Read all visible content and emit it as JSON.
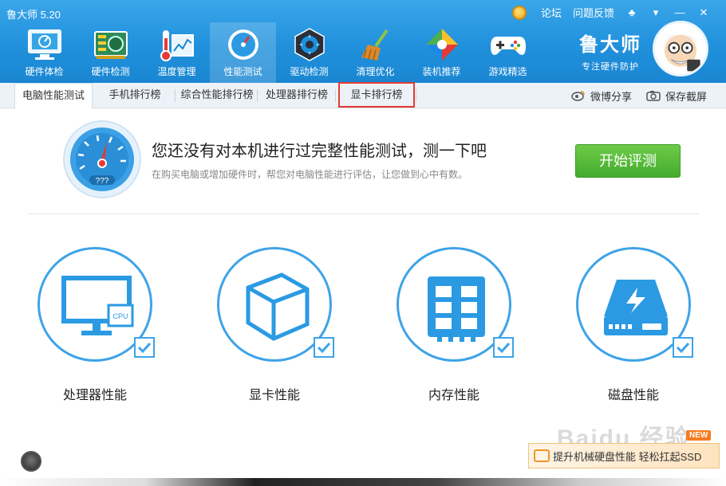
{
  "app": {
    "title": "鲁大师 5.20"
  },
  "topbar": {
    "forum": "论坛",
    "feedback": "问题反馈",
    "skin": "♣",
    "menu": "▾",
    "minimize": "—",
    "close": "✕"
  },
  "nav": [
    {
      "label": "硬件体检",
      "icon": "monitor-icon"
    },
    {
      "label": "硬件检测",
      "icon": "circuit-board-icon"
    },
    {
      "label": "温度管理",
      "icon": "thermometer-icon"
    },
    {
      "label": "性能测试",
      "icon": "speedometer-icon",
      "active": true
    },
    {
      "label": "驱动检测",
      "icon": "gear-icon"
    },
    {
      "label": "清理优化",
      "icon": "broom-icon"
    },
    {
      "label": "装机推荐",
      "icon": "cube-icon"
    },
    {
      "label": "游戏精选",
      "icon": "gamepad-icon"
    }
  ],
  "brand": {
    "name": "鲁大师",
    "slogan": "专注硬件防护"
  },
  "tabs": [
    {
      "label": "电脑性能测试",
      "active": true
    },
    {
      "label": "手机排行榜"
    },
    {
      "label": "综合性能排行榜"
    },
    {
      "label": "处理器排行榜"
    },
    {
      "label": "显卡排行榜"
    }
  ],
  "tab_tools": {
    "share": "微博分享",
    "screenshot": "保存截屏"
  },
  "intro": {
    "gauge_text": "???",
    "title": "您还没有对本机进行过完整性能测试，测一下吧",
    "subtitle": "在购买电脑或增加硬件时，帮您对电脑性能进行评估，让您做到心中有数。",
    "start_button": "开始评测"
  },
  "perf_items": [
    {
      "label": "处理器性能",
      "icon": "cpu-monitor-icon",
      "badge": "CPU"
    },
    {
      "label": "显卡性能",
      "icon": "3d-cube-icon"
    },
    {
      "label": "内存性能",
      "icon": "memory-chip-icon"
    },
    {
      "label": "磁盘性能",
      "icon": "hard-drive-icon"
    }
  ],
  "banner": {
    "text": "提升机械硬盘性能  轻松扛起SSD",
    "new_badge": "NEW",
    "watermark": "Baidu 经验"
  },
  "colors": {
    "header": "#2191dc",
    "accent": "#3ea3e8",
    "start": "#43ab2c",
    "highlight": "#e53935"
  }
}
